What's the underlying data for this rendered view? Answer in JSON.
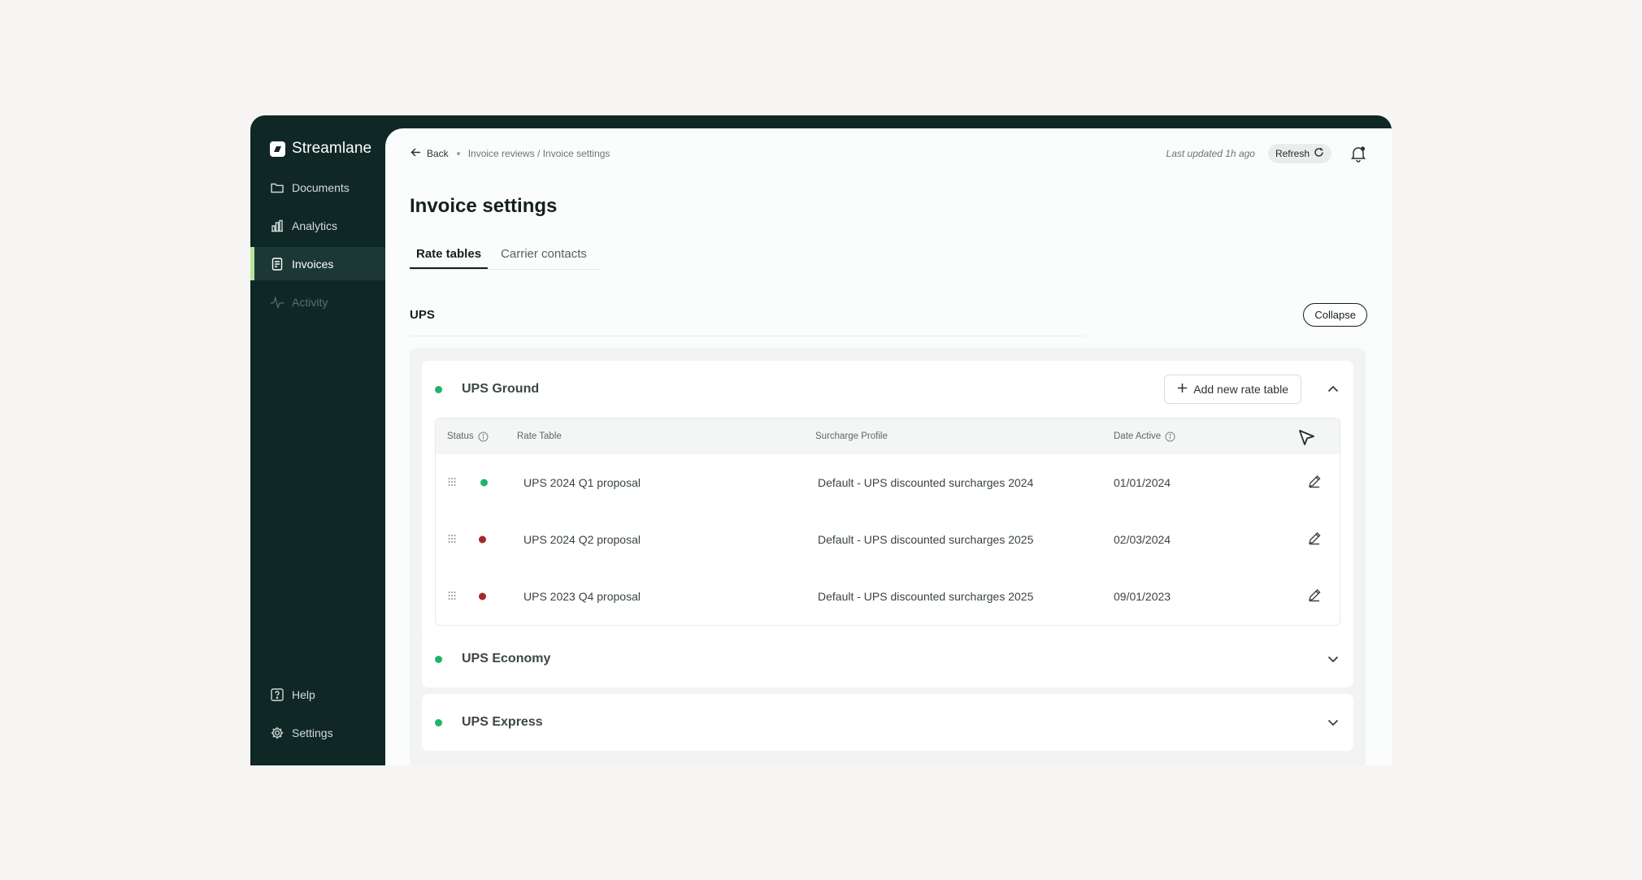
{
  "app": {
    "name": "Streamlane"
  },
  "sidebar": {
    "items": [
      {
        "label": "Documents",
        "icon": "folder-icon"
      },
      {
        "label": "Analytics",
        "icon": "bar-chart-icon"
      },
      {
        "label": "Invoices",
        "icon": "invoice-icon",
        "active": true
      },
      {
        "label": "Activity",
        "icon": "activity-icon",
        "disabled": true
      }
    ],
    "bottom": [
      {
        "label": "Help",
        "icon": "help-icon"
      },
      {
        "label": "Settings",
        "icon": "gear-icon"
      }
    ]
  },
  "topbar": {
    "back_label": "Back",
    "breadcrumb": "Invoice reviews / Invoice settings",
    "last_updated": "Last updated 1h ago",
    "refresh_label": "Refresh"
  },
  "page": {
    "title": "Invoice settings",
    "tabs": [
      {
        "label": "Rate tables",
        "active": true
      },
      {
        "label": "Carrier contacts",
        "active": false
      }
    ]
  },
  "section": {
    "title": "UPS",
    "collapse_label": "Collapse"
  },
  "carriers": [
    {
      "name": "UPS Ground",
      "status_color": "#1fb46c",
      "expanded": true,
      "add_label": "Add new rate table",
      "columns": {
        "status": "Status",
        "rate_table": "Rate Table",
        "surcharge": "Surcharge Profile",
        "date": "Date Active"
      },
      "rows": [
        {
          "status_color": "#1fb46c",
          "rate_table": "UPS 2024 Q1 proposal",
          "surcharge": "Default - UPS discounted surcharges 2024",
          "date": "01/01/2024"
        },
        {
          "status_color": "#a12b2b",
          "rate_table": "UPS 2024 Q2 proposal",
          "surcharge": "Default - UPS discounted surcharges 2025",
          "date": "02/03/2024"
        },
        {
          "status_color": "#a12b2b",
          "rate_table": "UPS 2023 Q4 proposal",
          "surcharge": "Default - UPS discounted surcharges 2025",
          "date": "09/01/2023"
        }
      ]
    },
    {
      "name": "UPS Economy",
      "status_color": "#1fb46c",
      "expanded": false
    },
    {
      "name": "UPS Express",
      "status_color": "#1fb46c",
      "expanded": false
    }
  ],
  "colors": {
    "sidebar_bg": "#0f2826",
    "accent": "#b5e59a",
    "active_green": "#1fb46c",
    "inactive_red": "#a12b2b"
  }
}
